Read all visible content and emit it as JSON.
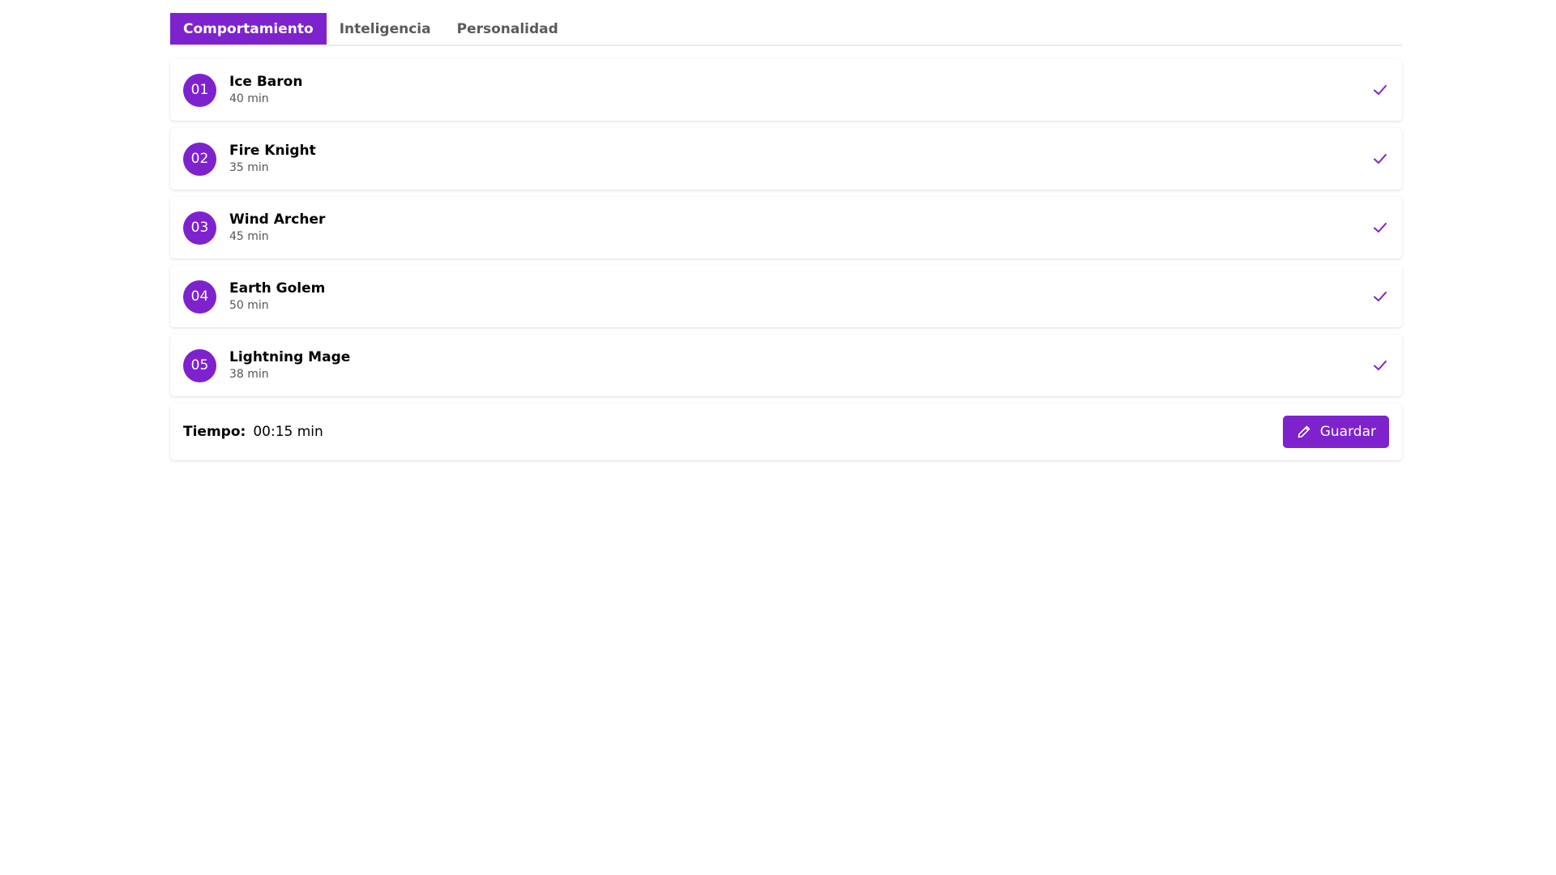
{
  "tabs": [
    {
      "label": "Comportamiento",
      "active": true
    },
    {
      "label": "Inteligencia",
      "active": false
    },
    {
      "label": "Personalidad",
      "active": false
    }
  ],
  "items": [
    {
      "number": "01",
      "title": "Ice Baron",
      "duration": "40 min",
      "status_icon": "check-icon"
    },
    {
      "number": "02",
      "title": "Fire Knight",
      "duration": "35 min",
      "status_icon": "check-icon"
    },
    {
      "number": "03",
      "title": "Wind Archer",
      "duration": "45 min",
      "status_icon": "check-icon"
    },
    {
      "number": "04",
      "title": "Earth Golem",
      "duration": "50 min",
      "status_icon": "check-icon"
    },
    {
      "number": "05",
      "title": "Lightning Mage",
      "duration": "38 min",
      "status_icon": "check-icon"
    }
  ],
  "footer": {
    "time_label": "Tiempo:",
    "time_value": "00:15 min",
    "save_label": "Guardar",
    "save_icon": "pencil-icon"
  },
  "colors": {
    "accent": "#7e22ce",
    "muted_text": "#555555",
    "tab_text": "#5a5a5a"
  }
}
